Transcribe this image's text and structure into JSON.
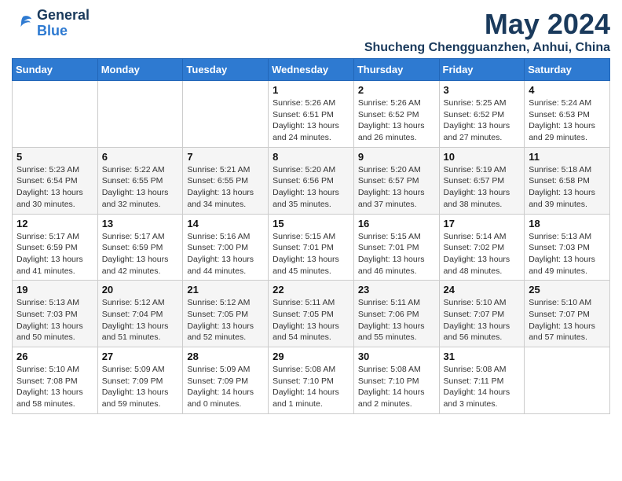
{
  "header": {
    "logo_line1": "General",
    "logo_line2": "Blue",
    "month_year": "May 2024",
    "location": "Shucheng Chengguanzhen, Anhui, China"
  },
  "weekdays": [
    "Sunday",
    "Monday",
    "Tuesday",
    "Wednesday",
    "Thursday",
    "Friday",
    "Saturday"
  ],
  "weeks": [
    [
      {
        "day": "",
        "info": ""
      },
      {
        "day": "",
        "info": ""
      },
      {
        "day": "",
        "info": ""
      },
      {
        "day": "1",
        "info": "Sunrise: 5:26 AM\nSunset: 6:51 PM\nDaylight: 13 hours\nand 24 minutes."
      },
      {
        "day": "2",
        "info": "Sunrise: 5:26 AM\nSunset: 6:52 PM\nDaylight: 13 hours\nand 26 minutes."
      },
      {
        "day": "3",
        "info": "Sunrise: 5:25 AM\nSunset: 6:52 PM\nDaylight: 13 hours\nand 27 minutes."
      },
      {
        "day": "4",
        "info": "Sunrise: 5:24 AM\nSunset: 6:53 PM\nDaylight: 13 hours\nand 29 minutes."
      }
    ],
    [
      {
        "day": "5",
        "info": "Sunrise: 5:23 AM\nSunset: 6:54 PM\nDaylight: 13 hours\nand 30 minutes."
      },
      {
        "day": "6",
        "info": "Sunrise: 5:22 AM\nSunset: 6:55 PM\nDaylight: 13 hours\nand 32 minutes."
      },
      {
        "day": "7",
        "info": "Sunrise: 5:21 AM\nSunset: 6:55 PM\nDaylight: 13 hours\nand 34 minutes."
      },
      {
        "day": "8",
        "info": "Sunrise: 5:20 AM\nSunset: 6:56 PM\nDaylight: 13 hours\nand 35 minutes."
      },
      {
        "day": "9",
        "info": "Sunrise: 5:20 AM\nSunset: 6:57 PM\nDaylight: 13 hours\nand 37 minutes."
      },
      {
        "day": "10",
        "info": "Sunrise: 5:19 AM\nSunset: 6:57 PM\nDaylight: 13 hours\nand 38 minutes."
      },
      {
        "day": "11",
        "info": "Sunrise: 5:18 AM\nSunset: 6:58 PM\nDaylight: 13 hours\nand 39 minutes."
      }
    ],
    [
      {
        "day": "12",
        "info": "Sunrise: 5:17 AM\nSunset: 6:59 PM\nDaylight: 13 hours\nand 41 minutes."
      },
      {
        "day": "13",
        "info": "Sunrise: 5:17 AM\nSunset: 6:59 PM\nDaylight: 13 hours\nand 42 minutes."
      },
      {
        "day": "14",
        "info": "Sunrise: 5:16 AM\nSunset: 7:00 PM\nDaylight: 13 hours\nand 44 minutes."
      },
      {
        "day": "15",
        "info": "Sunrise: 5:15 AM\nSunset: 7:01 PM\nDaylight: 13 hours\nand 45 minutes."
      },
      {
        "day": "16",
        "info": "Sunrise: 5:15 AM\nSunset: 7:01 PM\nDaylight: 13 hours\nand 46 minutes."
      },
      {
        "day": "17",
        "info": "Sunrise: 5:14 AM\nSunset: 7:02 PM\nDaylight: 13 hours\nand 48 minutes."
      },
      {
        "day": "18",
        "info": "Sunrise: 5:13 AM\nSunset: 7:03 PM\nDaylight: 13 hours\nand 49 minutes."
      }
    ],
    [
      {
        "day": "19",
        "info": "Sunrise: 5:13 AM\nSunset: 7:03 PM\nDaylight: 13 hours\nand 50 minutes."
      },
      {
        "day": "20",
        "info": "Sunrise: 5:12 AM\nSunset: 7:04 PM\nDaylight: 13 hours\nand 51 minutes."
      },
      {
        "day": "21",
        "info": "Sunrise: 5:12 AM\nSunset: 7:05 PM\nDaylight: 13 hours\nand 52 minutes."
      },
      {
        "day": "22",
        "info": "Sunrise: 5:11 AM\nSunset: 7:05 PM\nDaylight: 13 hours\nand 54 minutes."
      },
      {
        "day": "23",
        "info": "Sunrise: 5:11 AM\nSunset: 7:06 PM\nDaylight: 13 hours\nand 55 minutes."
      },
      {
        "day": "24",
        "info": "Sunrise: 5:10 AM\nSunset: 7:07 PM\nDaylight: 13 hours\nand 56 minutes."
      },
      {
        "day": "25",
        "info": "Sunrise: 5:10 AM\nSunset: 7:07 PM\nDaylight: 13 hours\nand 57 minutes."
      }
    ],
    [
      {
        "day": "26",
        "info": "Sunrise: 5:10 AM\nSunset: 7:08 PM\nDaylight: 13 hours\nand 58 minutes."
      },
      {
        "day": "27",
        "info": "Sunrise: 5:09 AM\nSunset: 7:09 PM\nDaylight: 13 hours\nand 59 minutes."
      },
      {
        "day": "28",
        "info": "Sunrise: 5:09 AM\nSunset: 7:09 PM\nDaylight: 14 hours\nand 0 minutes."
      },
      {
        "day": "29",
        "info": "Sunrise: 5:08 AM\nSunset: 7:10 PM\nDaylight: 14 hours\nand 1 minute."
      },
      {
        "day": "30",
        "info": "Sunrise: 5:08 AM\nSunset: 7:10 PM\nDaylight: 14 hours\nand 2 minutes."
      },
      {
        "day": "31",
        "info": "Sunrise: 5:08 AM\nSunset: 7:11 PM\nDaylight: 14 hours\nand 3 minutes."
      },
      {
        "day": "",
        "info": ""
      }
    ]
  ]
}
